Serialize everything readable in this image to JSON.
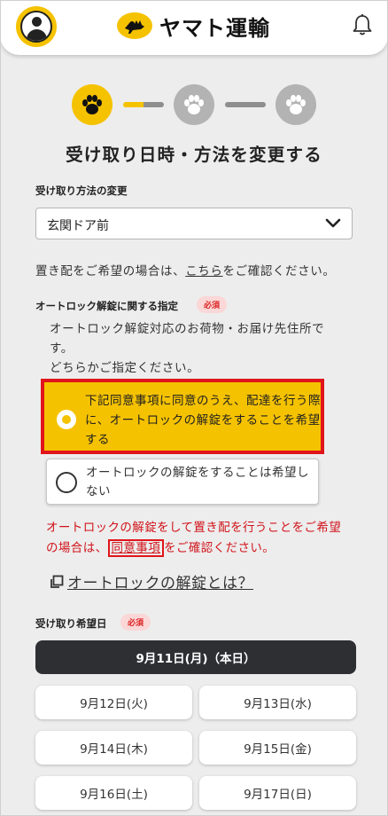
{
  "header": {
    "logo_text": "ヤマト運輸",
    "avatar_icon": "user-icon",
    "bell_icon": "bell-icon",
    "brand_color": "#F5C200"
  },
  "steps": {
    "current": 1,
    "total": 3
  },
  "page_title": "受け取り日時・方法を変更する",
  "method": {
    "label": "受け取り方法の変更",
    "selected": "玄関ドア前",
    "note_prefix": "置き配をご希望の場合は、",
    "note_link": "こちら",
    "note_suffix": "をご確認ください。"
  },
  "autolock": {
    "label": "オートロック解錠に関する指定",
    "required_badge": "必須",
    "desc_line1": "オートロック解錠対応のお荷物・お届け先住所で",
    "desc_line2": "す。",
    "desc_line3": "どちらかご指定ください。",
    "option1": "下記同意事項に同意のうえ、配達を行う際に、オートロックの解錠をすることを希望する",
    "option2": "オートロックの解錠をすることは希望しない",
    "warning_prefix": "オートロックの解錠をして置き配を行うことをご希望の場合は、",
    "warning_link": "同意事項",
    "warning_suffix": "をご確認ください。",
    "info_link": "オートロックの解錠とは？"
  },
  "date": {
    "label": "受け取り希望日",
    "required_badge": "必須",
    "options": [
      "9月11日(月)（本日）",
      "9月12日(火)",
      "9月13日(水)",
      "9月14日(木)",
      "9月15日(金)",
      "9月16日(土)",
      "9月17日(日)"
    ],
    "selected_index": 0
  }
}
